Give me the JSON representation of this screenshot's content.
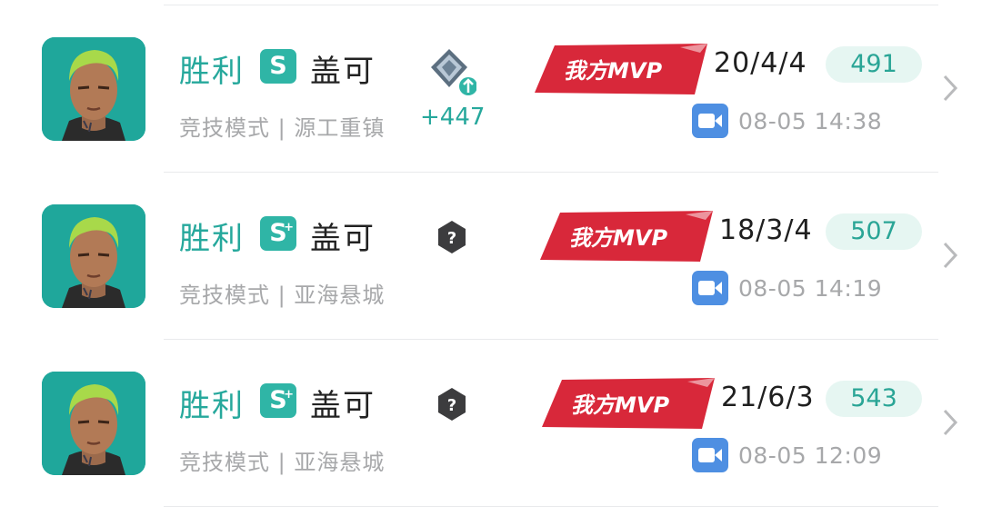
{
  "matches": [
    {
      "result": "胜利",
      "rank": "S",
      "rank_sup": "",
      "hero": "盖可",
      "mode": "竞技模式 | 源工重镇",
      "tier_icon": "silver-tier-up-icon",
      "points": "+447",
      "mvp": "我方MVP",
      "kda": "20/4/4",
      "score": "491",
      "time": "08-05 14:38"
    },
    {
      "result": "胜利",
      "rank": "S",
      "rank_sup": "+",
      "hero": "盖可",
      "mode": "竞技模式 | 亚海悬城",
      "tier_icon": "unknown-tier-icon",
      "points": "",
      "mvp": "我方MVP",
      "kda": "18/3/4",
      "score": "507",
      "time": "08-05 14:19"
    },
    {
      "result": "胜利",
      "rank": "S",
      "rank_sup": "+",
      "hero": "盖可",
      "mode": "竞技模式 | 亚海悬城",
      "tier_icon": "unknown-tier-icon",
      "points": "",
      "mvp": "我方MVP",
      "kda": "21/6/3",
      "score": "543",
      "time": "08-05 12:09"
    }
  ],
  "colors": {
    "accent": "#26a89c",
    "mvp_red": "#d8283a",
    "video_blue": "#4e8fe2",
    "score_bg": "#e6f6f2"
  }
}
